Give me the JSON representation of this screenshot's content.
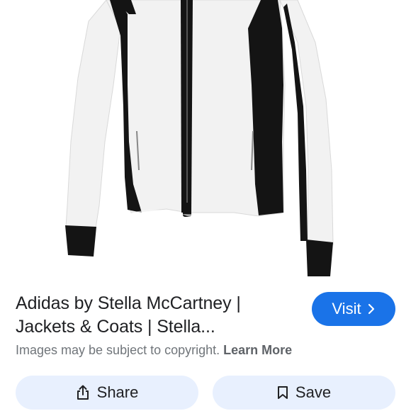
{
  "image": {
    "icon": "product-photo-jacket",
    "colors": {
      "body": "#f2f2f2",
      "panels": "#141414",
      "shadow": "#d9d9d9"
    }
  },
  "result": {
    "title_line1": "Adidas by Stella McCartney |",
    "title_line2": "Jackets & Coats | Stella...",
    "copyright_text": "Images may be subject to copyright. ",
    "learn_more": "Learn More"
  },
  "buttons": {
    "visit_label": "Visit",
    "visit_icon": "chevron-right-icon",
    "share_label": "Share",
    "share_icon": "share-icon",
    "save_label": "Save",
    "save_icon": "bookmark-icon"
  },
  "colors": {
    "accent": "#1a73e8",
    "chip_bg": "#e8f0fe",
    "text_primary": "#202124",
    "text_secondary": "#70757a"
  }
}
